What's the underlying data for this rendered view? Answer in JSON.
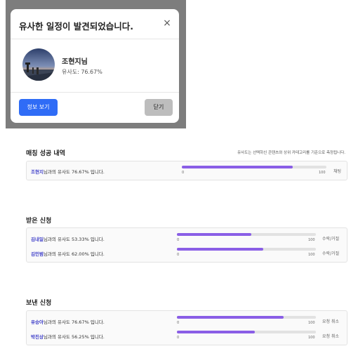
{
  "modal": {
    "title": "유사한 일정이 발견되었습니다.",
    "close_icon": "×",
    "name": "조현지님",
    "similarity": "유사도: 76.67%",
    "view_button": "정보 보기",
    "close_button": "닫기"
  },
  "matched": {
    "title": "매칭 성공 내역",
    "note": "유사도는 선택하신 콘텐츠와 상위 카테고리를 기준으로 측정됩니다.",
    "rows": [
      {
        "name": "조현지",
        "suffix": "님과의 유사도 76.67% 입니다.",
        "progress": 0.7667,
        "min": "0",
        "max": "100",
        "action": "채팅"
      }
    ]
  },
  "received": {
    "title": "받은 신청",
    "rows": [
      {
        "name": "김내일",
        "suffix": "님과의 유사도 53.33% 입니다.",
        "progress": 0.5333,
        "min": "0",
        "max": "100",
        "action": "수락/거절"
      },
      {
        "name": "김민범",
        "suffix": "님과의 유사도 62.00% 입니다.",
        "progress": 0.62,
        "min": "0",
        "max": "100",
        "action": "수락/거절"
      }
    ]
  },
  "sent": {
    "title": "보낸 신청",
    "rows": [
      {
        "name": "유승아",
        "suffix": "님과의 유사도 76.67% 입니다.",
        "progress": 0.7667,
        "min": "0",
        "max": "100",
        "action": "요청 취소"
      },
      {
        "name": "박진상",
        "suffix": "님과의 유사도 56.25% 입니다.",
        "progress": 0.5625,
        "min": "0",
        "max": "100",
        "action": "요청 취소"
      }
    ]
  },
  "colors": {
    "accent": "#2f6cf6",
    "bar": "#8a5ee6",
    "name": "#3c3cc8"
  }
}
